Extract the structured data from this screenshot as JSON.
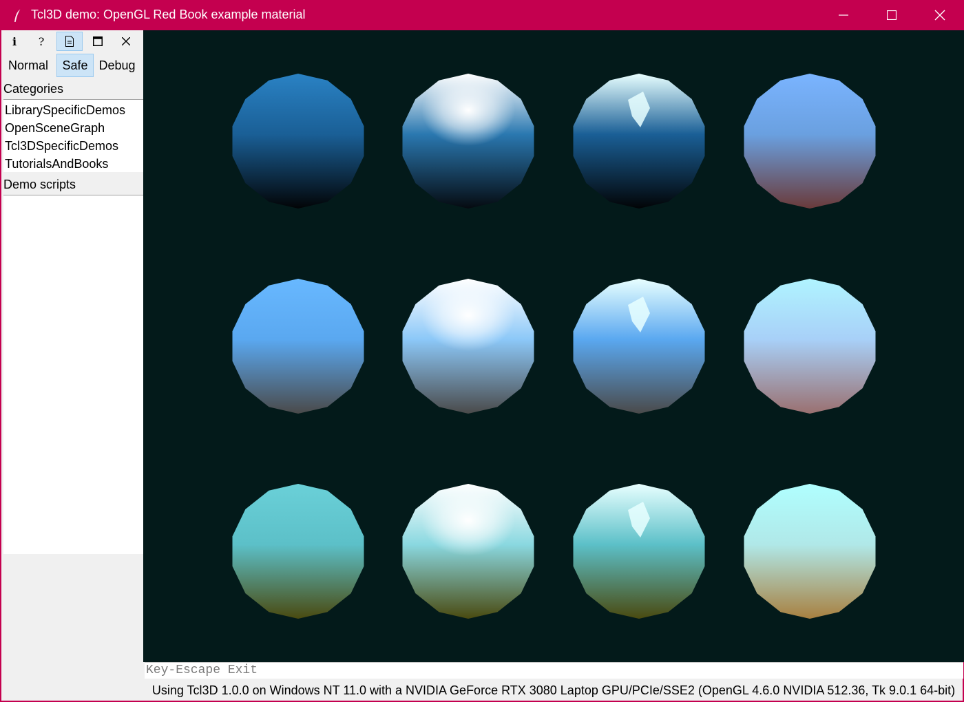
{
  "window": {
    "title": "Tcl3D demo: OpenGL Red Book example material",
    "accent_color": "#c4004f",
    "controls": [
      "minimize-icon",
      "maximize-icon",
      "close-icon"
    ]
  },
  "toolbar": {
    "buttons": [
      {
        "name": "info-button",
        "glyph": "i",
        "icon": "info-icon"
      },
      {
        "name": "help-button",
        "glyph": "?",
        "icon": "help-icon"
      },
      {
        "name": "source-button",
        "glyph": "",
        "icon": "document-icon",
        "active": true
      },
      {
        "name": "fullscreen-button",
        "glyph": "",
        "icon": "window-icon"
      },
      {
        "name": "close-demo-button",
        "glyph": "✕",
        "icon": "close-icon"
      }
    ],
    "modes": [
      "Normal",
      "Safe",
      "Debug"
    ],
    "active_mode": "Safe"
  },
  "sidebar": {
    "categories_label": "Categories",
    "categories": [
      "LibrarySpecificDemos",
      "OpenSceneGraph",
      "Tcl3DSpecificDemos",
      "TutorialsAndBooks"
    ],
    "scripts_label": "Demo scripts",
    "scripts": []
  },
  "scene": {
    "background_color": "#031a1a",
    "rows": 3,
    "columns": 4,
    "spheres": [
      {
        "row": 1,
        "col": 1,
        "base": "#1a5f96",
        "highlight": "#2a82c4",
        "shade": "#020406"
      },
      {
        "row": 1,
        "col": 2,
        "base": "#2a78b0",
        "highlight": "#ffffff",
        "shade": "#050a10"
      },
      {
        "row": 1,
        "col": 3,
        "base": "#1a5f96",
        "highlight": "#e8ffff",
        "shade": "#020406"
      },
      {
        "row": 1,
        "col": 4,
        "base": "#6aa0e0",
        "highlight": "#7ab4ff",
        "shade": "#6a3a3a"
      },
      {
        "row": 2,
        "col": 1,
        "base": "#5aa8f0",
        "highlight": "#68b8ff",
        "shade": "#4a4a4a"
      },
      {
        "row": 2,
        "col": 2,
        "base": "#8cc8f8",
        "highlight": "#ffffff",
        "shade": "#4a4a4a"
      },
      {
        "row": 2,
        "col": 3,
        "base": "#5aa8f0",
        "highlight": "#e8ffff",
        "shade": "#4a4a4a"
      },
      {
        "row": 2,
        "col": 4,
        "base": "#a8d0f8",
        "highlight": "#b0f4ff",
        "shade": "#9a7070"
      },
      {
        "row": 3,
        "col": 1,
        "base": "#5cc0c8",
        "highlight": "#6ad0d8",
        "shade": "#4a4a10"
      },
      {
        "row": 3,
        "col": 2,
        "base": "#8ad8e0",
        "highlight": "#ffffff",
        "shade": "#4a4a10"
      },
      {
        "row": 3,
        "col": 3,
        "base": "#5cc0c8",
        "highlight": "#e8ffff",
        "shade": "#4a4a10"
      },
      {
        "row": 3,
        "col": 4,
        "base": "#b0e8e8",
        "highlight": "#b0ffff",
        "shade": "#a88040"
      }
    ]
  },
  "key_help": "Key-Escape Exit",
  "status": "Using Tcl3D 1.0.0 on Windows NT 11.0 with a NVIDIA GeForce RTX 3080 Laptop GPU/PCIe/SSE2 (OpenGL 4.6.0 NVIDIA 512.36, Tk 9.0.1 64-bit)"
}
